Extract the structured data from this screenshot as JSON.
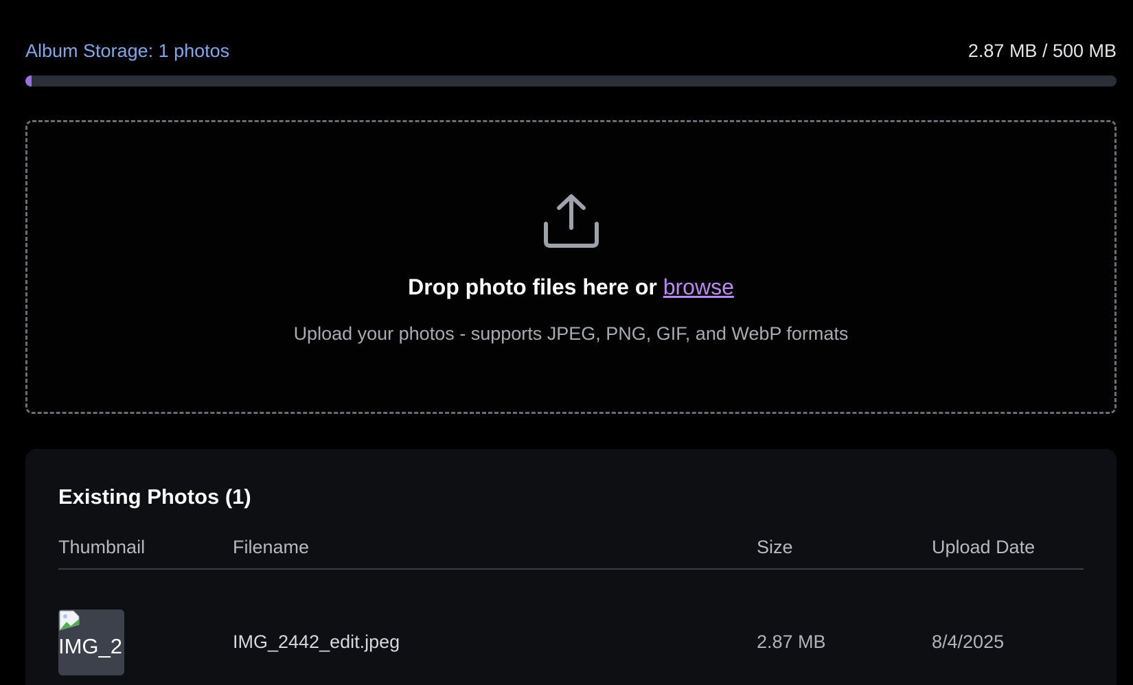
{
  "storage": {
    "label": "Album Storage: 1 photos",
    "usage": "2.87 MB / 500 MB",
    "used_fraction": 0.00574,
    "accent_color": "#7fa9ee"
  },
  "dropzone": {
    "icon": "upload-icon",
    "title_prefix": "Drop photo files here or ",
    "browse_label": "browse",
    "subtitle": "Upload your photos - supports JPEG, PNG, GIF, and WebP formats",
    "link_color": "#b88af2"
  },
  "photos": {
    "title": "Existing Photos (1)",
    "columns": [
      "Thumbnail",
      "Filename",
      "Size",
      "Upload Date"
    ],
    "rows": [
      {
        "thumbnail_alt": "IMG_2",
        "thumbnail_icon": "broken-image-icon",
        "filename": "IMG_2442_edit.jpeg",
        "size": "2.87 MB",
        "upload_date": "8/4/2025"
      }
    ]
  }
}
